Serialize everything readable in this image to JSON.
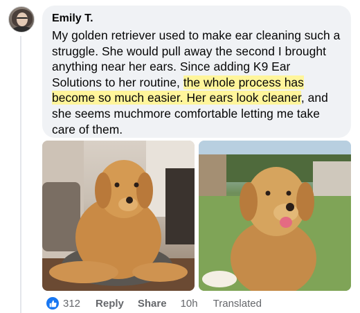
{
  "comment": {
    "author": "Emily T.",
    "text_segments": [
      {
        "text": "My golden retriever used to make ear cleaning such a struggle. She would pull away the second I brought anything near her ears. Since adding K9 Ear Solutions to her routine, ",
        "highlight": false
      },
      {
        "text": "the whole process has become so much easier. Her ears look cleaner",
        "highlight": true
      },
      {
        "text": ", and she seems muchmore comfortable letting me take care of them.",
        "highlight": false
      }
    ]
  },
  "actions": {
    "reaction_icon": "thumbs-up-icon",
    "reaction_count": "312",
    "reply_label": "Reply",
    "share_label": "Share",
    "time": "10h",
    "translated_label": "Translated"
  },
  "colors": {
    "bubble_bg": "#f0f2f5",
    "highlight": "#fff59b",
    "meta_text": "#65676b",
    "like_blue": "#1877f2"
  }
}
